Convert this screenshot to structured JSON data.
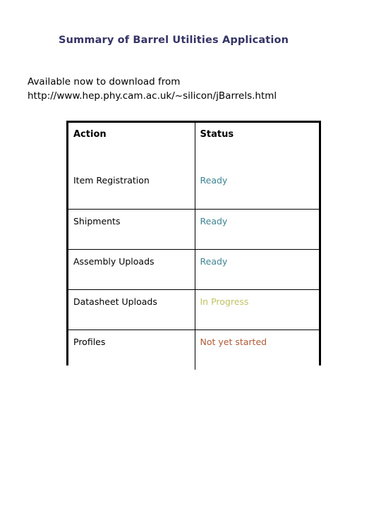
{
  "slide": {
    "title": "Summary of Barrel Utilities Application",
    "title_color": "#333366",
    "background_color": "#ffffff"
  },
  "intro": {
    "line1": "Available now to download from",
    "line2": "http://www.hep.phy.cam.ac.uk/~silicon/jBarrels.html",
    "text_color": "#000000"
  },
  "table": {
    "headers": {
      "action": "Action",
      "status": "Status"
    },
    "border_color": "#000000",
    "rows": [
      {
        "action": "Item Registration",
        "status": "Ready",
        "status_color": "#3d8494"
      },
      {
        "action": "Shipments",
        "status": "Ready",
        "status_color": "#3d8494"
      },
      {
        "action": "Assembly Uploads",
        "status": "Ready",
        "status_color": "#3d8494"
      },
      {
        "action": "Datasheet Uploads",
        "status": "In Progress",
        "status_color": "#c2c265"
      },
      {
        "action": "Profiles",
        "status": "Not yet started",
        "status_color": "#b05a36"
      }
    ]
  }
}
